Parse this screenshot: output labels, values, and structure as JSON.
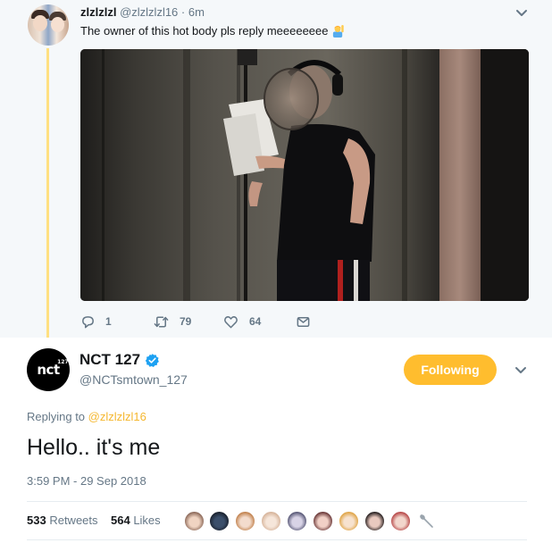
{
  "parent_tweet": {
    "display_name": "zlzlzlzl",
    "handle": "@zlzlzlzl16",
    "separator": "·",
    "time": "6m",
    "text": "The owner of this hot body pls reply meeeeeeee",
    "emoji": "person-raising-hand",
    "actions": {
      "reply_count": "1",
      "retweet_count": "79",
      "like_count": "64"
    }
  },
  "main_tweet": {
    "display_name": "NCT 127",
    "handle": "@NCTsmtown_127",
    "avatar_text": "nct",
    "avatar_sup": "127",
    "follow_label": "Following",
    "replying_prefix": "Replying to",
    "replying_to": "@zlzlzlzl16",
    "text": "Hello.. it's me",
    "timestamp": "3:59 PM - 29 Sep 2018",
    "stats": {
      "retweets_count": "533",
      "retweets_label": "Retweets",
      "likes_count": "564",
      "likes_label": "Likes"
    },
    "liker_avatar_count": 9
  },
  "colors": {
    "accent": "#ffbd2e",
    "mention": "#f5b72f",
    "thread_line": "#ffe082",
    "muted": "#657786",
    "verified": "#1da1f2",
    "parent_bg": "#f5f8fa"
  }
}
